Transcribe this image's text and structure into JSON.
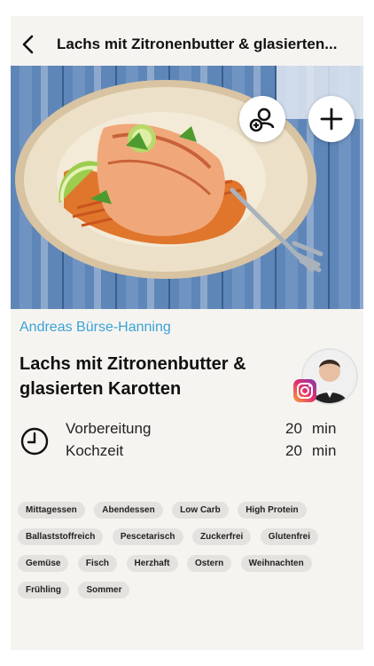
{
  "nav": {
    "title": "Lachs mit Zitronenbutter & glasierten..."
  },
  "hero": {
    "image": "salmon-with-carrots-photo"
  },
  "author": {
    "name": "Andreas Bürse-Hanning"
  },
  "recipe": {
    "title": "Lachs mit Zitronenbutter & glasierten Karotten"
  },
  "times": [
    {
      "label": "Vorbereitung",
      "value": "20",
      "unit": "min"
    },
    {
      "label": "Kochzeit",
      "value": "20",
      "unit": "min"
    }
  ],
  "tags": [
    "Mittagessen",
    "Abendessen",
    "Low Carb",
    "High Protein",
    "Ballaststoffreich",
    "Pescetarisch",
    "Zuckerfrei",
    "Glutenfrei",
    "Gemüse",
    "Fisch",
    "Herzhaft",
    "Ostern",
    "Weihnachten",
    "Frühling",
    "Sommer"
  ],
  "colors": {
    "accent": "#3aa3d6",
    "background": "#f6f4f1",
    "tag_bg": "#e4e2df"
  }
}
